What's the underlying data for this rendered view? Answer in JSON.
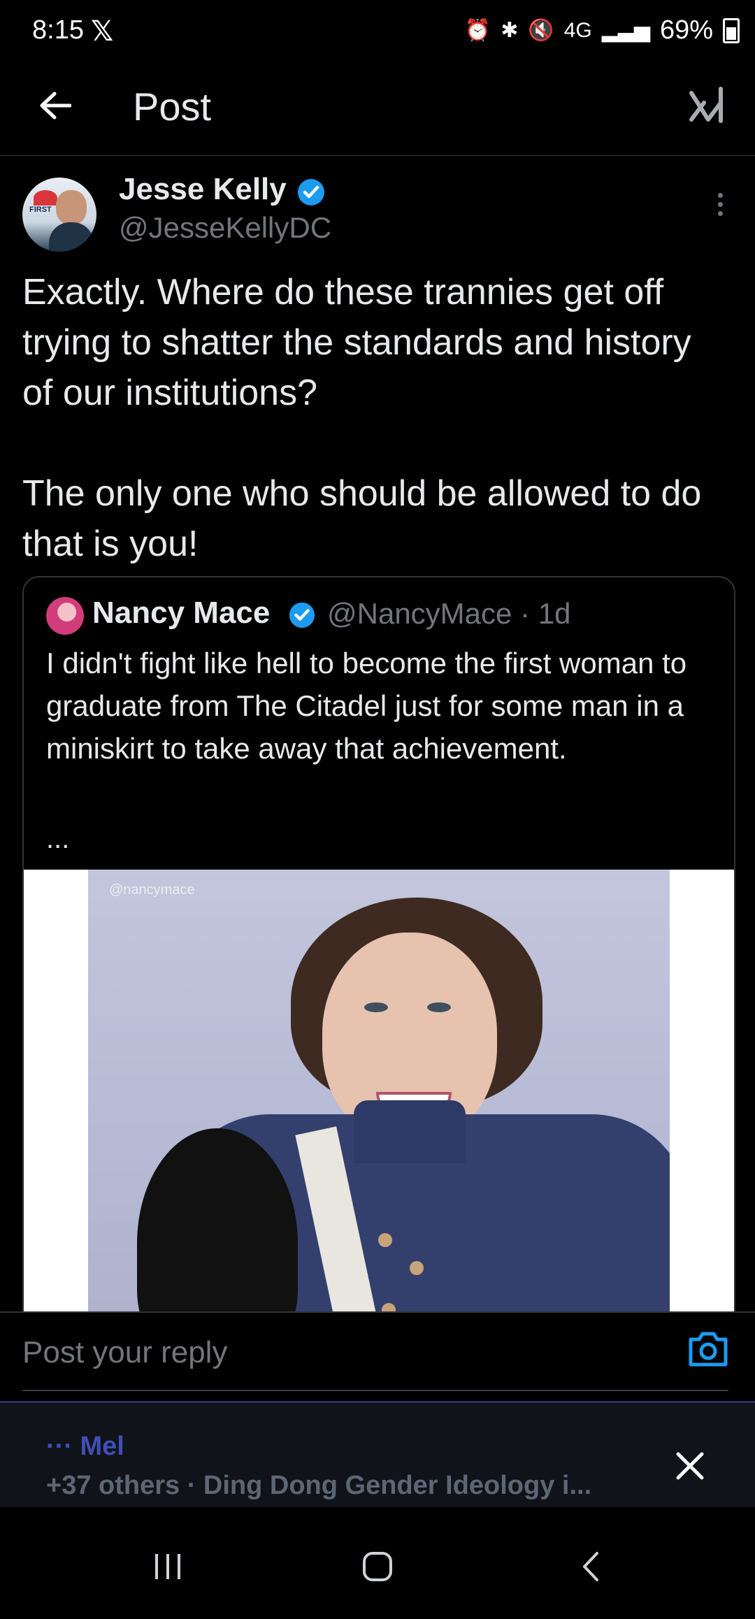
{
  "status_bar": {
    "time": "8:15",
    "battery": "69%",
    "network": "4G"
  },
  "header": {
    "title": "Post"
  },
  "post": {
    "author_name": "Jesse Kelly",
    "author_handle": "@JesseKellyDC",
    "avatar_text": "FIRST",
    "text": "Exactly. Where do these trannies get off trying to shatter the standards and history of our institutions?\n\nThe only one who should be allowed to do that is you!"
  },
  "quote": {
    "author_name": "Nancy Mace",
    "author_handle": "@NancyMace",
    "time": "· 1d",
    "text": "I didn't fight like hell to become the first woman to graduate from The Citadel just for some man in a miniskirt to take away that achievement.",
    "ellipsis": "...",
    "watermark": "@nancymace"
  },
  "reply": {
    "placeholder": "Post your reply"
  },
  "now_playing": {
    "title": "··· Mel",
    "subtitle": "+37 others · Ding Dong Gender Ideology i..."
  },
  "colors": {
    "verified": "#1d9bf0",
    "accent": "#7a5af5",
    "background": "#000000"
  }
}
